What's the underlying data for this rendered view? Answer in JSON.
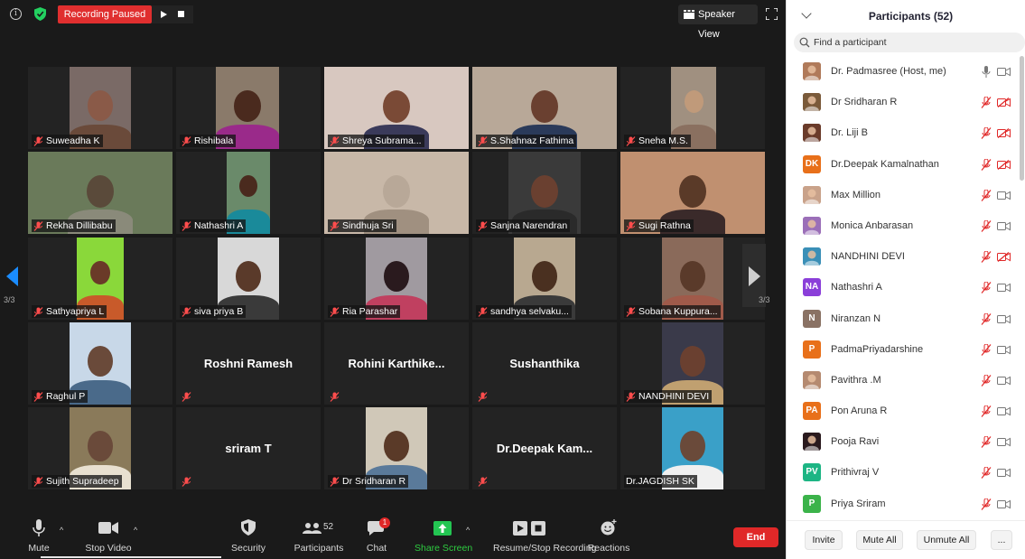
{
  "topbar": {
    "recording_label": "Recording Paused",
    "speaker_view_label": "Speaker View"
  },
  "gallery": {
    "page_indicator_left": "3/3",
    "page_indicator_right": "3/3",
    "tiles": [
      {
        "name": "Suweadha K",
        "video": true,
        "muted": true
      },
      {
        "name": "Rishibala",
        "video": true,
        "muted": true
      },
      {
        "name": "Shreya Subrama...",
        "video": true,
        "muted": true
      },
      {
        "name": "S.Shahnaz Fathima",
        "video": true,
        "muted": true
      },
      {
        "name": "Sneha M.S.",
        "video": true,
        "muted": true
      },
      {
        "name": "Rekha Dillibabu",
        "video": true,
        "muted": true
      },
      {
        "name": "Nathashri A",
        "video": true,
        "muted": true
      },
      {
        "name": "Sindhuja Sri",
        "video": true,
        "muted": true
      },
      {
        "name": "Sanjna Narendran",
        "video": true,
        "muted": true
      },
      {
        "name": "Sugi Rathna",
        "video": true,
        "muted": true
      },
      {
        "name": "Sathyapriya L",
        "video": true,
        "muted": true
      },
      {
        "name": "siva priya B",
        "video": true,
        "muted": true
      },
      {
        "name": "Ria Parashar",
        "video": true,
        "muted": true
      },
      {
        "name": "sandhya selvaku...",
        "video": true,
        "muted": true
      },
      {
        "name": "Sobana Kuppura...",
        "video": true,
        "muted": true
      },
      {
        "name": "Raghul P",
        "video": true,
        "muted": true
      },
      {
        "name": "Roshni Ramesh",
        "video": false,
        "muted": true
      },
      {
        "name": "Rohini  Karthike...",
        "video": false,
        "muted": true
      },
      {
        "name": "Sushanthika",
        "video": false,
        "muted": true
      },
      {
        "name": "NANDHINI DEVI",
        "video": true,
        "muted": true
      },
      {
        "name": "Sujith Supradeep",
        "video": true,
        "muted": true
      },
      {
        "name": "sriram T",
        "video": false,
        "muted": true
      },
      {
        "name": "Dr Sridharan R",
        "video": true,
        "muted": true
      },
      {
        "name": "Dr.Deepak  Kam...",
        "video": false,
        "muted": true
      },
      {
        "name": "Dr.JAGDISH SK",
        "video": true,
        "muted": false
      }
    ]
  },
  "toolbar": {
    "mute": "Mute",
    "stop_video": "Stop Video",
    "security": "Security",
    "participants": "Participants",
    "participants_count": "52",
    "chat": "Chat",
    "chat_badge": "1",
    "share_screen": "Share Screen",
    "resume_stop_recording": "Resume/Stop Recording",
    "reactions": "Reactions",
    "end": "End"
  },
  "panel": {
    "title": "Participants (52)",
    "search_placeholder": "Find a participant",
    "participants": [
      {
        "name": "Dr. Padmasree (Host, me)",
        "avatar_type": "photo",
        "avatar_color": "#b07a5a",
        "mic": "on",
        "cam": "on"
      },
      {
        "name": "Dr Sridharan R",
        "avatar_type": "photo",
        "avatar_color": "#7a5a3a",
        "mic": "muted",
        "cam": "off"
      },
      {
        "name": "Dr. Liji B",
        "avatar_type": "photo",
        "avatar_color": "#6a3b2a",
        "mic": "muted",
        "cam": "off"
      },
      {
        "name": "Dr.Deepak Kamalnathan",
        "avatar_type": "initials",
        "initials": "DK",
        "avatar_color": "#e8701a",
        "mic": "muted",
        "cam": "off"
      },
      {
        "name": "Max Million",
        "avatar_type": "photo",
        "avatar_color": "#c9a28a",
        "mic": "muted",
        "cam": "on"
      },
      {
        "name": "Monica Anbarasan",
        "avatar_type": "photo",
        "avatar_color": "#9b6fb8",
        "mic": "muted",
        "cam": "on"
      },
      {
        "name": "NANDHINI DEVI",
        "avatar_type": "photo",
        "avatar_color": "#3a8fb7",
        "mic": "muted",
        "cam": "off"
      },
      {
        "name": "Nathashri A",
        "avatar_type": "initials",
        "initials": "NA",
        "avatar_color": "#8b3fd9",
        "mic": "muted",
        "cam": "on"
      },
      {
        "name": "Niranzan N",
        "avatar_type": "initials",
        "initials": "N",
        "avatar_color": "#8a7264",
        "mic": "muted",
        "cam": "on"
      },
      {
        "name": "PadmaPriyadarshine",
        "avatar_type": "initials",
        "initials": "P",
        "avatar_color": "#e8701a",
        "mic": "muted",
        "cam": "on"
      },
      {
        "name": "Pavithra .M",
        "avatar_type": "photo",
        "avatar_color": "#b58a70",
        "mic": "muted",
        "cam": "on"
      },
      {
        "name": "Pon Aruna R",
        "avatar_type": "initials",
        "initials": "PA",
        "avatar_color": "#e8701a",
        "mic": "muted",
        "cam": "on"
      },
      {
        "name": "Pooja Ravi",
        "avatar_type": "photo",
        "avatar_color": "#2a1a1e",
        "mic": "muted",
        "cam": "on"
      },
      {
        "name": "Prithivraj V",
        "avatar_type": "initials",
        "initials": "PV",
        "avatar_color": "#1db584",
        "mic": "muted",
        "cam": "on"
      },
      {
        "name": "Priya Sriram",
        "avatar_type": "initials",
        "initials": "P",
        "avatar_color": "#3bb34a",
        "mic": "muted",
        "cam": "on"
      }
    ],
    "invite": "Invite",
    "mute_all": "Mute All",
    "unmute_all": "Unmute All",
    "more": "..."
  }
}
